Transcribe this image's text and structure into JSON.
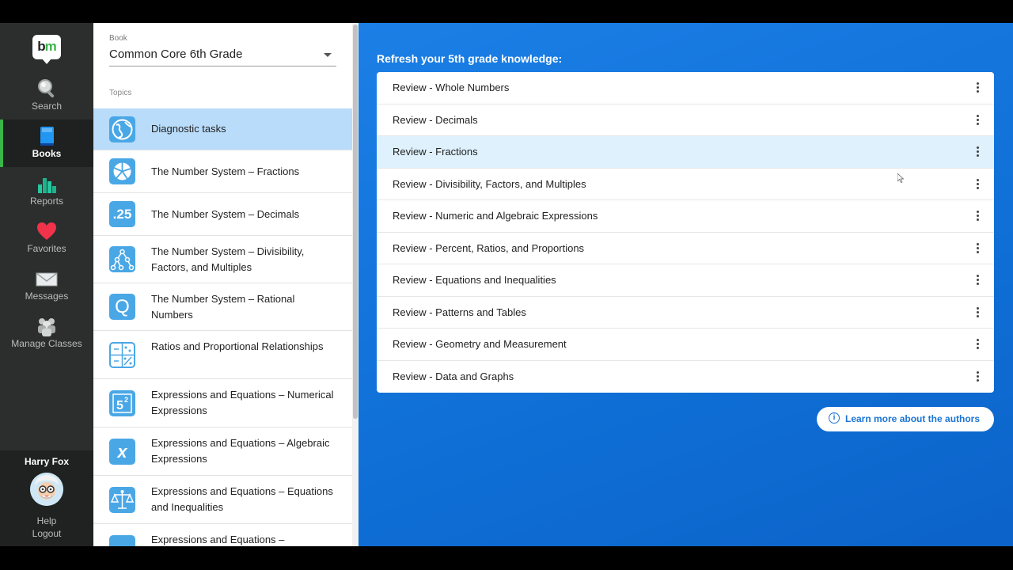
{
  "nav": {
    "logo": "bm",
    "items": [
      {
        "label": "Search",
        "icon": "search-icon"
      },
      {
        "label": "Books",
        "icon": "book-icon",
        "active": true
      },
      {
        "label": "Reports",
        "icon": "bar-chart-icon"
      },
      {
        "label": "Favorites",
        "icon": "heart-icon"
      },
      {
        "label": "Messages",
        "icon": "envelope-icon"
      },
      {
        "label": "Manage Classes",
        "icon": "classes-icon"
      }
    ],
    "user_name": "Harry Fox",
    "help_label": "Help",
    "logout_label": "Logout"
  },
  "panel": {
    "book_label": "Book",
    "book_value": "Common Core 6th Grade",
    "topics_label": "Topics",
    "topics": [
      {
        "label": "Diagnostic tasks",
        "icon": "globe-icon",
        "selected": true
      },
      {
        "label": "The Number System – Fractions",
        "icon": "pie-chart-icon"
      },
      {
        "label": "The Number System – Decimals",
        "icon": "decimal-icon",
        "icon_text": ".25"
      },
      {
        "label": "The Number System – Divisibility, Factors, and Multiples",
        "icon": "factor-tree-icon"
      },
      {
        "label": "The Number System – Rational Numbers",
        "icon": "rational-q-icon",
        "icon_text": "Q"
      },
      {
        "label": "Ratios and Proportional Relationships",
        "icon": "ratio-icon"
      },
      {
        "label": "Expressions and Equations – Numerical Expressions",
        "icon": "exponent-icon"
      },
      {
        "label": "Expressions and Equations – Algebraic Expressions",
        "icon": "variable-x-icon",
        "icon_text": "x"
      },
      {
        "label": "Expressions and Equations – Equations and Inequalities",
        "icon": "balance-scale-icon"
      },
      {
        "label": "Expressions and Equations –",
        "icon": "graph-icon"
      }
    ]
  },
  "main": {
    "title": "Refresh your 5th grade knowledge:",
    "reviews": [
      {
        "label": "Review - Whole Numbers"
      },
      {
        "label": "Review - Decimals"
      },
      {
        "label": "Review - Fractions",
        "hover": true
      },
      {
        "label": "Review - Divisibility, Factors, and Multiples"
      },
      {
        "label": "Review - Numeric and Algebraic Expressions"
      },
      {
        "label": "Review - Percent, Ratios, and Proportions"
      },
      {
        "label": "Review - Equations and Inequalities"
      },
      {
        "label": "Review - Patterns and Tables"
      },
      {
        "label": "Review - Geometry and Measurement"
      },
      {
        "label": "Review - Data and Graphs"
      }
    ],
    "authors_button": "Learn more about the authors"
  },
  "colors": {
    "accent_green": "#39b54a",
    "nav_bg": "#2b2e2c",
    "main_blue": "#1276dd",
    "topic_selected": "#b8dcfa",
    "review_hover": "#def1fd"
  }
}
